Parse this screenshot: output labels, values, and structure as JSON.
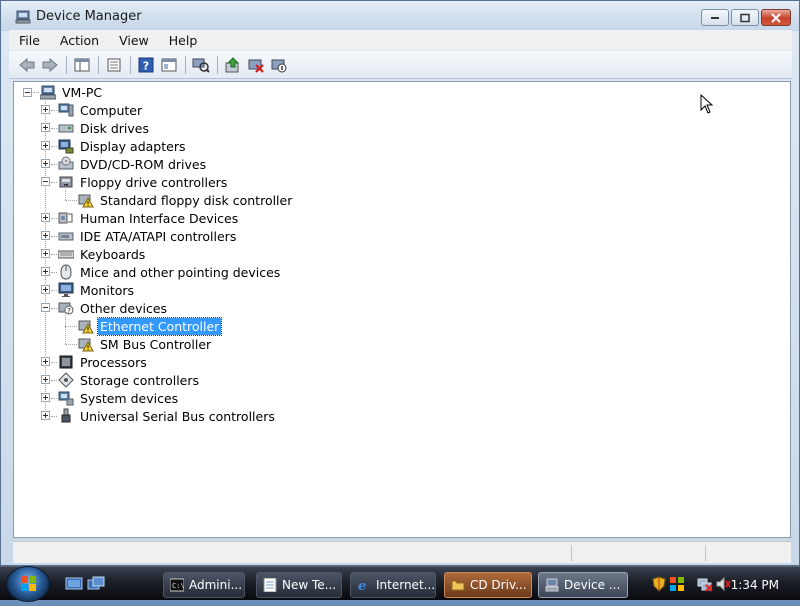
{
  "window": {
    "title": "Device Manager",
    "icon": "device-manager-icon"
  },
  "menu": [
    "File",
    "Action",
    "View",
    "Help"
  ],
  "toolbar": {
    "buttons": [
      "back-icon",
      "forward-icon",
      "properties-view-icon",
      "console-tree-icon",
      "help-icon",
      "view-icon",
      "scan-hardware-icon",
      "update-driver-icon",
      "uninstall-icon",
      "disable-icon"
    ]
  },
  "tree": {
    "root": "VM-PC",
    "items": [
      {
        "label": "Computer",
        "icon": "computer-icon",
        "expanded": false
      },
      {
        "label": "Disk drives",
        "icon": "disk-drive-icon",
        "expanded": false
      },
      {
        "label": "Display adapters",
        "icon": "display-adapter-icon",
        "expanded": false
      },
      {
        "label": "DVD/CD-ROM drives",
        "icon": "dvd-drive-icon",
        "expanded": false
      },
      {
        "label": "Floppy drive controllers",
        "icon": "floppy-controller-icon",
        "expanded": true
      },
      {
        "label": "Standard floppy disk controller",
        "icon": "warning-device-icon",
        "child": true
      },
      {
        "label": "Human Interface Devices",
        "icon": "hid-icon",
        "expanded": false
      },
      {
        "label": "IDE ATA/ATAPI controllers",
        "icon": "ide-controller-icon",
        "expanded": false
      },
      {
        "label": "Keyboards",
        "icon": "keyboard-icon",
        "expanded": false
      },
      {
        "label": "Mice and other pointing devices",
        "icon": "mouse-icon",
        "expanded": false
      },
      {
        "label": "Monitors",
        "icon": "monitor-icon",
        "expanded": false
      },
      {
        "label": "Other devices",
        "icon": "other-devices-icon",
        "expanded": true
      },
      {
        "label": "Ethernet Controller",
        "icon": "warning-device-icon",
        "child": true,
        "selected": true
      },
      {
        "label": "SM Bus Controller",
        "icon": "warning-device-icon",
        "child": true
      },
      {
        "label": "Processors",
        "icon": "processor-icon",
        "expanded": false
      },
      {
        "label": "Storage controllers",
        "icon": "storage-controller-icon",
        "expanded": false
      },
      {
        "label": "System devices",
        "icon": "system-devices-icon",
        "expanded": false
      },
      {
        "label": "Universal Serial Bus controllers",
        "icon": "usb-icon",
        "expanded": false
      }
    ]
  },
  "taskbar": {
    "tasks": [
      {
        "label": "Admini...",
        "icon": "cmd-icon"
      },
      {
        "label": "New Te...",
        "icon": "notepad-icon"
      },
      {
        "label": "Internet...",
        "icon": "ie-icon"
      },
      {
        "label": "CD Driv...",
        "icon": "folder-icon"
      },
      {
        "label": "Device ...",
        "icon": "device-manager-icon"
      }
    ],
    "clock": "1:34 PM"
  }
}
